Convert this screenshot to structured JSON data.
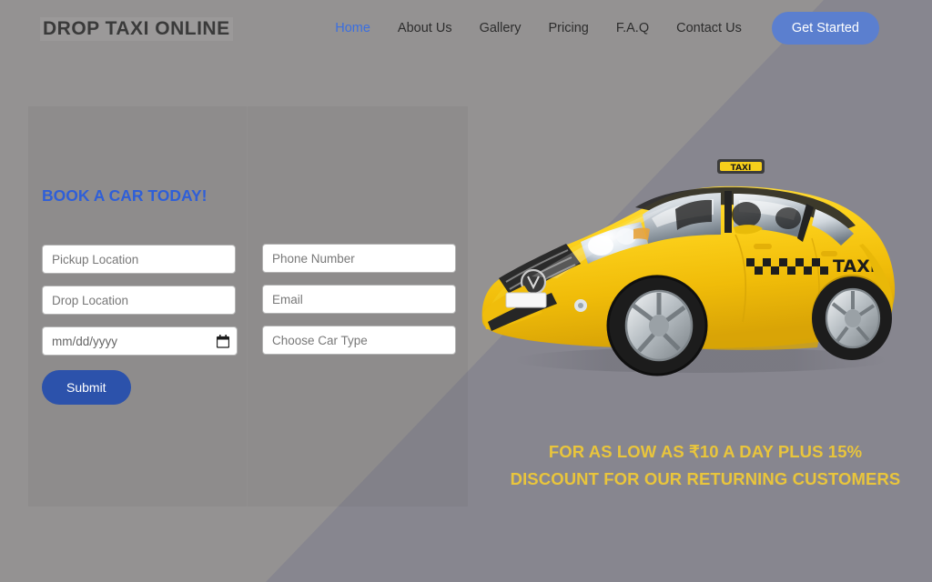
{
  "header": {
    "logo": "DROP TAXI ONLINE",
    "nav_items": [
      {
        "label": "Home",
        "active": true
      },
      {
        "label": "About Us",
        "active": false
      },
      {
        "label": "Gallery",
        "active": false
      },
      {
        "label": "Pricing",
        "active": false
      },
      {
        "label": "F.A.Q",
        "active": false
      },
      {
        "label": "Contact Us",
        "active": false
      }
    ],
    "cta_label": "Get Started"
  },
  "booking_form": {
    "heading": "BOOK A CAR TODAY!",
    "pickup_placeholder": "Pickup Location",
    "pickup_value": "",
    "drop_placeholder": "Drop Location",
    "drop_value": "",
    "date_placeholder": "mm/dd/yyyy",
    "date_value": "",
    "date_icon": "calendar-icon",
    "phone_placeholder": "Phone Number",
    "phone_value": "",
    "email_placeholder": "Email",
    "email_value": "",
    "cartype_placeholder": "Choose Car Type",
    "cartype_value": "",
    "submit_label": "Submit"
  },
  "hero": {
    "image_alt": "yellow-taxi-sedan",
    "roof_sign_text": "TAXI",
    "door_badge_text": "TAXI",
    "promo_line1": "FOR AS LOW AS ₹10 A DAY PLUS 15%",
    "promo_line2": "DISCOUNT FOR OUR RETURNING CUSTOMERS"
  },
  "colors": {
    "accent_blue": "#2f5fd8",
    "nav_active": "#3b6fe0",
    "cta_blue": "#5b7fcf",
    "submit_blue": "#2c52ab",
    "promo_yellow": "#e9c53c",
    "bg_left": "#939191",
    "bg_right": "#868690",
    "taxi_yellow": "#f5c518"
  }
}
